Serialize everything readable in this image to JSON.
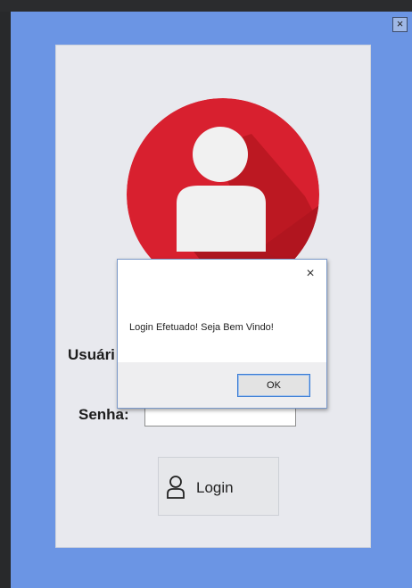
{
  "window": {
    "close_glyph": "×"
  },
  "form": {
    "username_label": "Usuári",
    "password_label": "Senha:",
    "login_label": "Login"
  },
  "dialog": {
    "message": "Login Efetuado! Seja Bem Vindo!",
    "ok_label": "OK",
    "close_glyph": "×"
  },
  "colors": {
    "window_bg": "#6b95e4",
    "panel_bg": "#e8e9ee",
    "avatar_red": "#d8202f",
    "avatar_shadow": "#a9151f",
    "icon_white": "#f1f1f1"
  },
  "icons": [
    "close-icon",
    "user-avatar-icon",
    "user-icon"
  ]
}
